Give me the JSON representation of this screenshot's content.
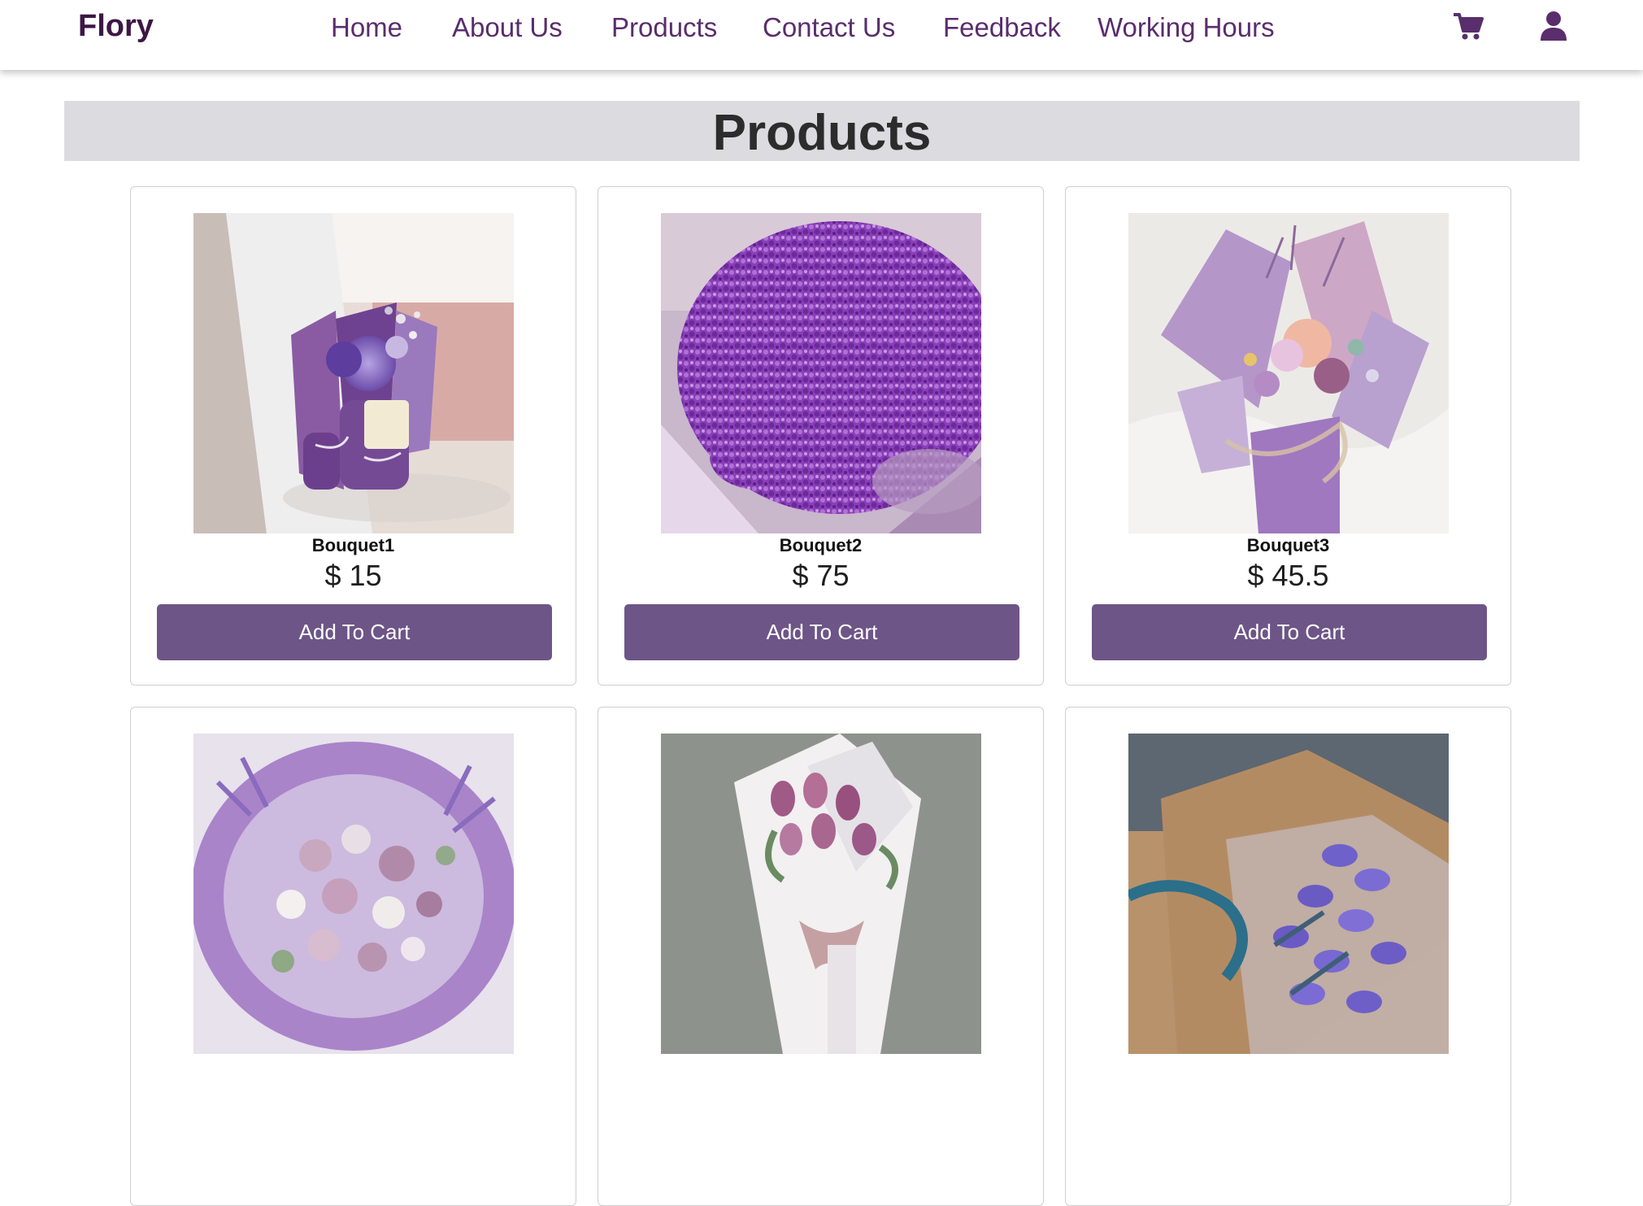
{
  "navbar": {
    "brand": "Flory",
    "links": [
      "Home",
      "About Us",
      "Products",
      "Contact Us",
      "Feedback",
      "Working Hours"
    ],
    "icons": [
      "cart-icon",
      "user-icon"
    ]
  },
  "page": {
    "title": "Products"
  },
  "products": [
    {
      "name": "Bouquet1",
      "price": "$ 15",
      "button": "Add To Cart",
      "image": "purple-bouquet-mirror"
    },
    {
      "name": "Bouquet2",
      "price": "$ 75",
      "button": "Add To Cart",
      "image": "purple-babys-breath"
    },
    {
      "name": "Bouquet3",
      "price": "$ 45.5",
      "button": "Add To Cart",
      "image": "lilac-mixed-bouquet"
    },
    {
      "image": "lavender-rose-bouquet"
    },
    {
      "image": "pink-tulips-white-wrap"
    },
    {
      "image": "purple-tulips-kraft-wrap"
    }
  ],
  "colors": {
    "brand": "#3d1745",
    "nav_text": "#5a2d6c",
    "button": "#6d5587",
    "title_band": "#dcdbe0"
  }
}
